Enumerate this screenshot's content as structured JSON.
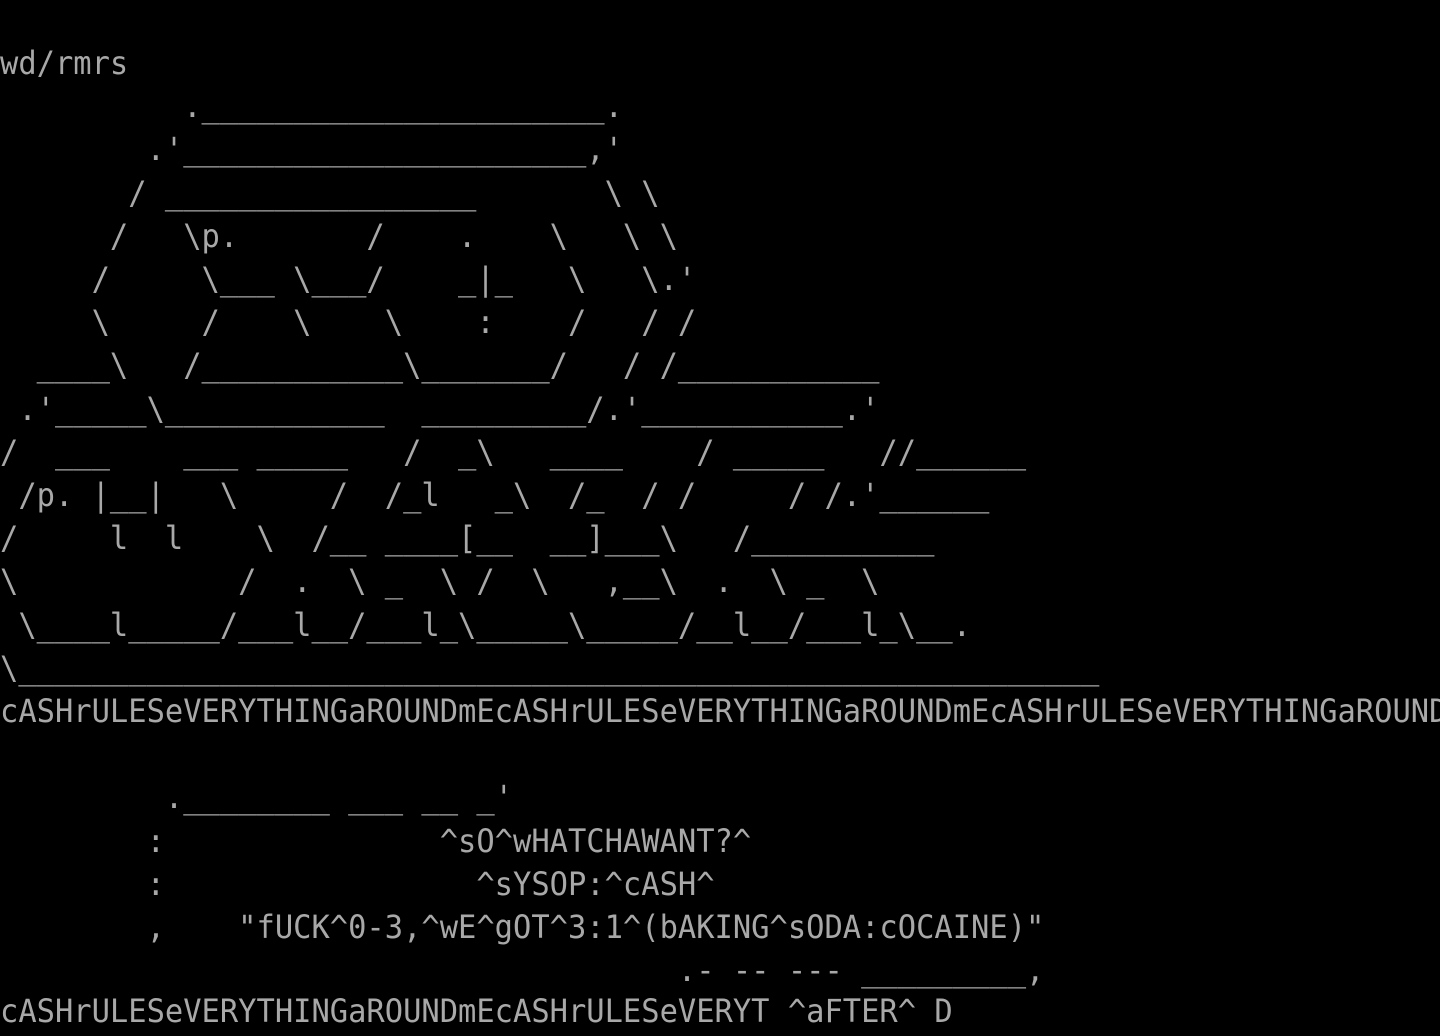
{
  "colors": {
    "background": "#000000",
    "foreground": "#a8a8a8"
  },
  "art_lines": [
    "wd/rmrs",
    "          .______________________.",
    "        .'______________________,'",
    "       / _________________       \\ \\",
    "      /   \\p.       /    .    \\   \\ \\",
    "     /     \\___ \\___/    _|_   \\   \\.'",
    "     \\     /    \\    \\    :    /   / /",
    "  ____\\   /___________\\_______/   / /___________",
    " .'_____\\____________  _________/.'___________.'",
    "/  ___    ___ _____   /  _\\   ____    / _____   //______",
    " /p. |__|   \\     /  /_l   _\\  /_  / /     / /.'______",
    "/     l  l    \\  /__ ____[__  __]___\\   /__________",
    "\\            /  .  \\ _  \\ /  \\   ,__\\  .  \\ _  \\",
    " \\____l_____/___l__/___l_\\_____\\_____/__l__/___l_\\__.",
    "\\___________________________________________________________",
    "cASHrULESeVERYTHINGaROUNDmEcASHrULESeVERYTHINGaROUNDmEcASHrULESeVERYTHINGaROUND",
    "",
    "         .________ ___ __ _'",
    "        :               ^sO^wHATCHAWANT?^",
    "        :                 ^sYSOP:^cASH^",
    "        ,    \"fUCK^0-3,^wE^gOT^3:1^(bAKING^sODA:cOCAINE)\"",
    "                                     .- -- --- _________,"
  ],
  "bottom_line": "cASHrULESeVERYTHINGaROUNDmEcASHrULESeVERYT ^aFTER^ D"
}
